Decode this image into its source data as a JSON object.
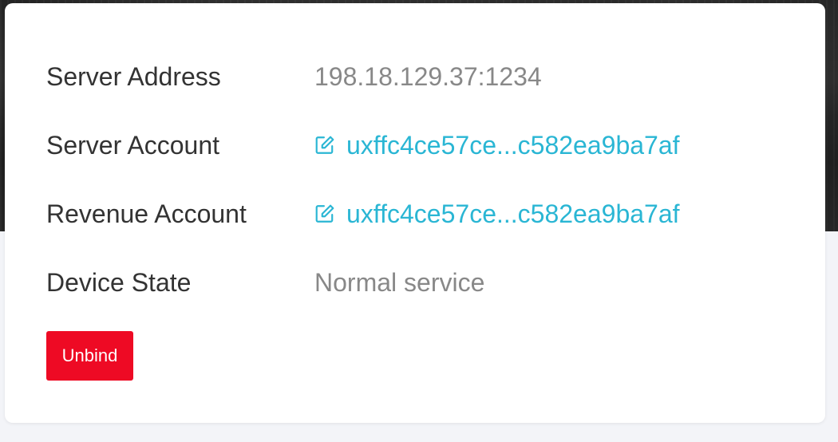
{
  "device_info": {
    "rows": [
      {
        "label": "Server Address",
        "value": "198.18.129.37:1234"
      },
      {
        "label": "Server Account",
        "value": "uxffc4ce57ce...c582ea9ba7af",
        "icon": "edit-icon"
      },
      {
        "label": "Revenue Account",
        "value": "uxffc4ce57ce...c582ea9ba7af",
        "icon": "edit-icon"
      },
      {
        "label": "Device State",
        "value": "Normal service"
      }
    ],
    "unbind_label": "Unbind"
  },
  "colors": {
    "link": "#2ab6d4",
    "label": "#333333",
    "value": "#888888",
    "danger": "#ee0a24"
  }
}
